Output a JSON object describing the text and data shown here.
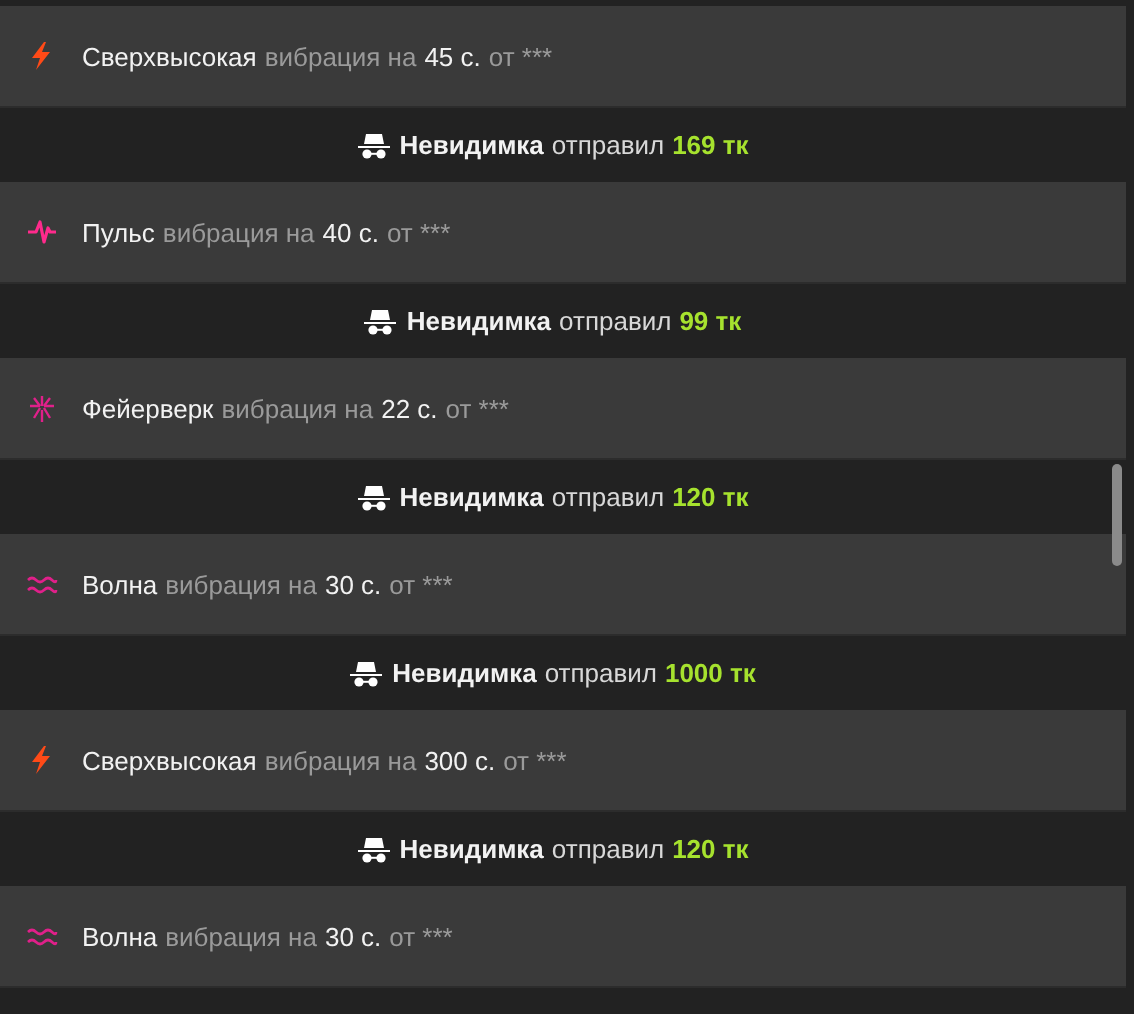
{
  "feed": [
    {
      "kind": "bolt",
      "name": "Сверхвысокая",
      "action": "вибрация на",
      "duration": "45 с.",
      "from": "от ***"
    },
    {
      "kind": "tip",
      "sender": "Невидимка",
      "action": "отправил",
      "amount": "169 тк"
    },
    {
      "kind": "pulse",
      "name": "Пульс",
      "action": "вибрация на",
      "duration": "40 с.",
      "from": "от ***"
    },
    {
      "kind": "tip",
      "sender": "Невидимка",
      "action": "отправил",
      "amount": "99 тк"
    },
    {
      "kind": "firework",
      "name": "Фейерверк",
      "action": "вибрация на",
      "duration": "22 с.",
      "from": "от ***"
    },
    {
      "kind": "tip",
      "sender": "Невидимка",
      "action": "отправил",
      "amount": "120 тк"
    },
    {
      "kind": "wave",
      "name": "Волна",
      "action": "вибрация на",
      "duration": "30 с.",
      "from": "от ***"
    },
    {
      "kind": "tip",
      "sender": "Невидимка",
      "action": "отправил",
      "amount": "1000 тк"
    },
    {
      "kind": "bolt",
      "name": "Сверхвысокая",
      "action": "вибрация на",
      "duration": "300 с.",
      "from": "от ***"
    },
    {
      "kind": "tip",
      "sender": "Невидимка",
      "action": "отправил",
      "amount": "120 тк"
    },
    {
      "kind": "wave",
      "name": "Волна",
      "action": "вибрация на",
      "duration": "30 с.",
      "from": "от ***"
    }
  ]
}
